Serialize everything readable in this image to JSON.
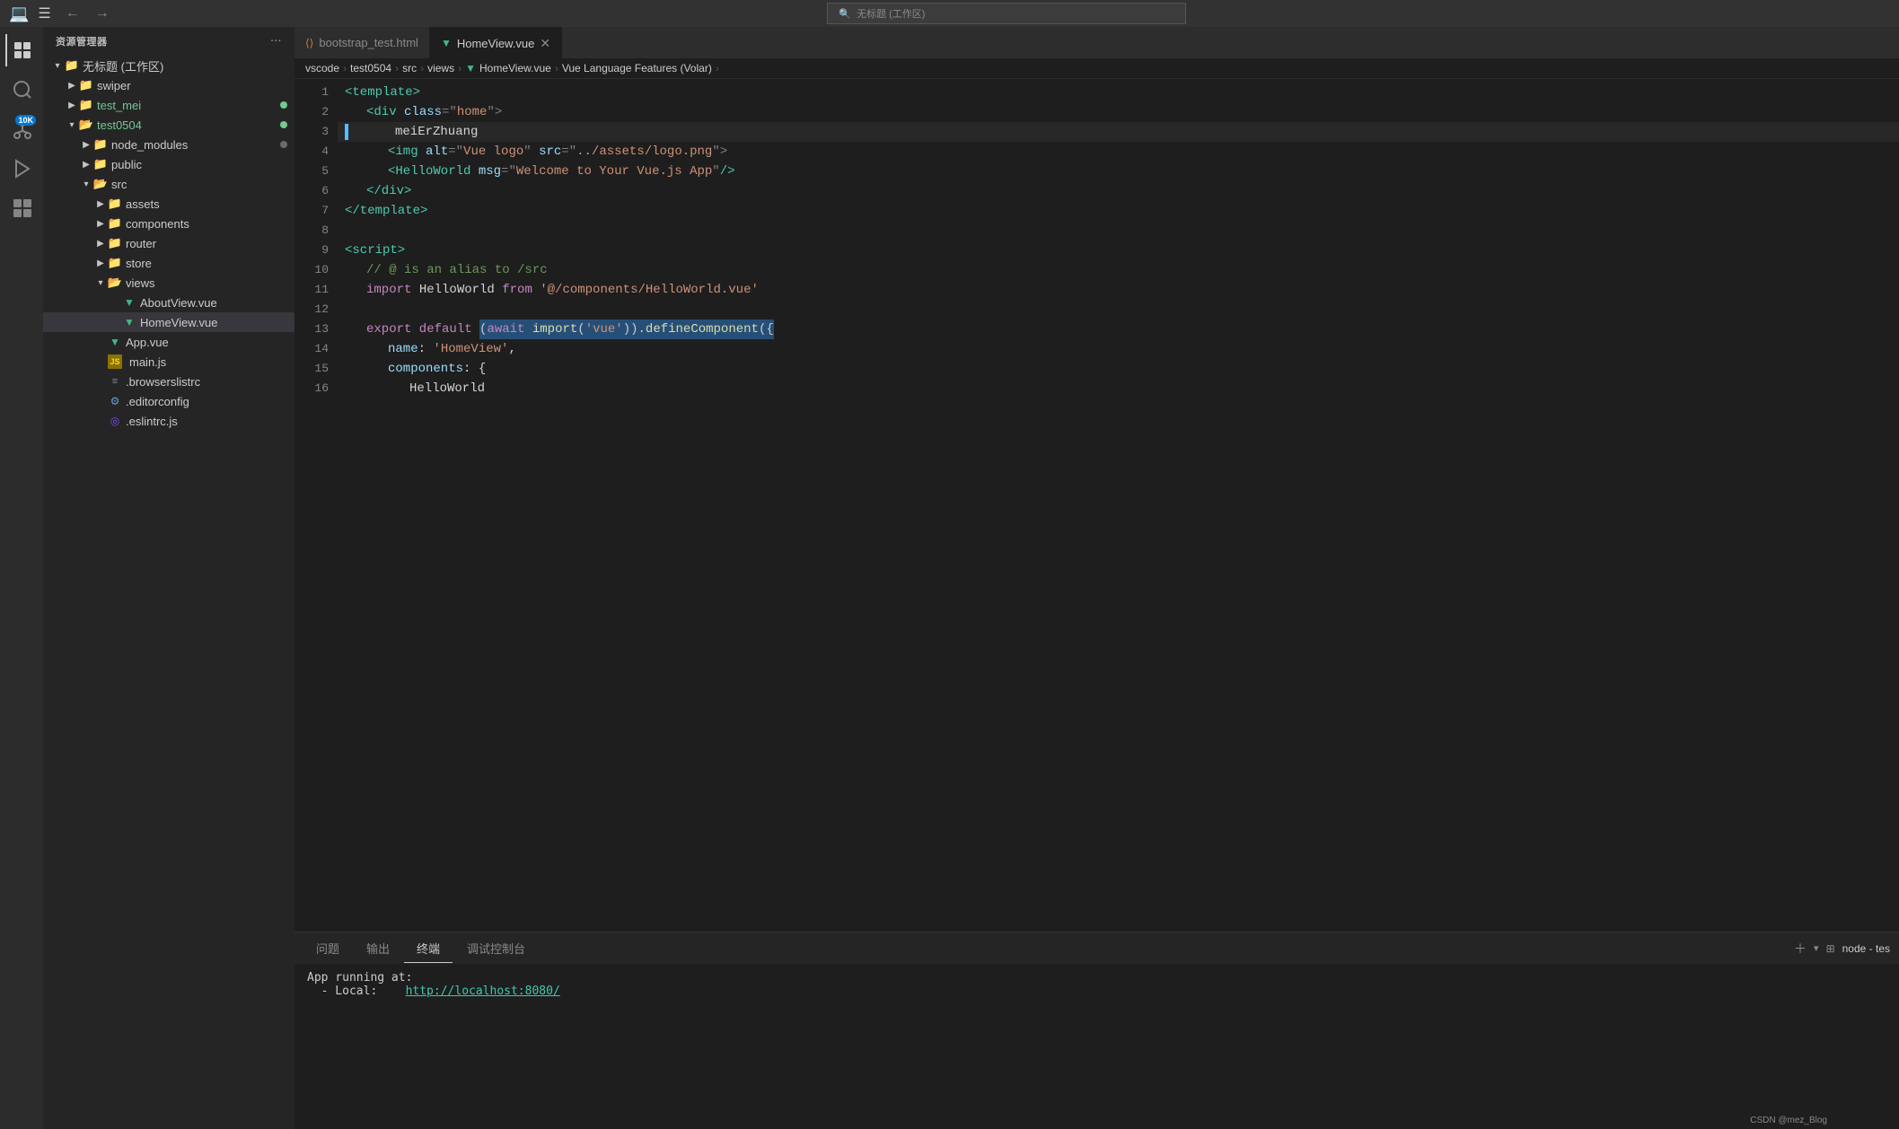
{
  "titlebar": {
    "title": "无标题 (工作区)",
    "back_label": "←",
    "forward_label": "→",
    "search_placeholder": "无标题 (工作区)"
  },
  "sidebar": {
    "header": "资源管理器",
    "workspace_label": "无标题 (工作区)",
    "items": [
      {
        "id": "swiper",
        "label": "swiper",
        "type": "folder",
        "level": 1,
        "expanded": false,
        "dot": ""
      },
      {
        "id": "test_mei",
        "label": "test_mei",
        "type": "folder",
        "level": 1,
        "expanded": false,
        "dot": "green",
        "color": "green"
      },
      {
        "id": "test0504",
        "label": "test0504",
        "type": "folder",
        "level": 1,
        "expanded": true,
        "dot": "green",
        "color": "green"
      },
      {
        "id": "node_modules",
        "label": "node_modules",
        "type": "folder",
        "level": 2,
        "expanded": false,
        "dot": "gray"
      },
      {
        "id": "public",
        "label": "public",
        "type": "folder",
        "level": 2,
        "expanded": false,
        "dot": ""
      },
      {
        "id": "src",
        "label": "src",
        "type": "folder",
        "level": 2,
        "expanded": true,
        "dot": ""
      },
      {
        "id": "assets",
        "label": "assets",
        "type": "folder",
        "level": 3,
        "expanded": false,
        "dot": ""
      },
      {
        "id": "components",
        "label": "components",
        "type": "folder",
        "level": 3,
        "expanded": false,
        "dot": ""
      },
      {
        "id": "router",
        "label": "router",
        "type": "folder",
        "level": 3,
        "expanded": false,
        "dot": ""
      },
      {
        "id": "store",
        "label": "store",
        "type": "folder",
        "level": 3,
        "expanded": false,
        "dot": ""
      },
      {
        "id": "views",
        "label": "views",
        "type": "folder",
        "level": 3,
        "expanded": true,
        "dot": ""
      },
      {
        "id": "aboutview",
        "label": "AboutView.vue",
        "type": "vue",
        "level": 4,
        "expanded": false,
        "dot": ""
      },
      {
        "id": "homeview",
        "label": "HomeView.vue",
        "type": "vue",
        "level": 4,
        "expanded": false,
        "dot": "",
        "selected": true
      },
      {
        "id": "appvue",
        "label": "App.vue",
        "type": "vue",
        "level": 3,
        "expanded": false,
        "dot": ""
      },
      {
        "id": "mainjs",
        "label": "main.js",
        "type": "js",
        "level": 3,
        "expanded": false,
        "dot": ""
      },
      {
        "id": "browserslistrc",
        "label": ".browserslistrc",
        "type": "config",
        "level": 3,
        "expanded": false,
        "dot": ""
      },
      {
        "id": "editorconfig",
        "label": ".editorconfig",
        "type": "gear",
        "level": 3,
        "expanded": false,
        "dot": ""
      },
      {
        "id": "eslintrc",
        "label": ".eslintrc.js",
        "type": "eslint",
        "level": 3,
        "expanded": false,
        "dot": ""
      }
    ]
  },
  "tabs": [
    {
      "id": "bootstrap",
      "label": "bootstrap_test.html",
      "icon": "html",
      "active": false
    },
    {
      "id": "homeview",
      "label": "HomeView.vue",
      "icon": "vue",
      "active": true,
      "closable": true
    }
  ],
  "breadcrumb": {
    "parts": [
      "vscode",
      "test0504",
      "src",
      "views",
      "HomeView.vue",
      "Vue Language Features (Volar)"
    ]
  },
  "code": {
    "lines": [
      {
        "num": 1,
        "content": "<template>"
      },
      {
        "num": 2,
        "content": "  <div class=\"home\">"
      },
      {
        "num": 3,
        "content": "    meiErZhuang",
        "active": true
      },
      {
        "num": 4,
        "content": "    <img alt=\"Vue logo\" src=\"../assets/logo.png\">"
      },
      {
        "num": 5,
        "content": "    <HelloWorld msg=\"Welcome to Your Vue.js App\"/>"
      },
      {
        "num": 6,
        "content": "  </div>"
      },
      {
        "num": 7,
        "content": "</template>"
      },
      {
        "num": 8,
        "content": ""
      },
      {
        "num": 9,
        "content": "<script>"
      },
      {
        "num": 10,
        "content": "// @ is an alias to /src"
      },
      {
        "num": 11,
        "content": "import HelloWorld from '@/components/HelloWorld.vue'"
      },
      {
        "num": 12,
        "content": ""
      },
      {
        "num": 13,
        "content": "export default (await import('vue')).defineComponent({"
      },
      {
        "num": 14,
        "content": "  name: 'HomeView',"
      },
      {
        "num": 15,
        "content": "  components: {"
      },
      {
        "num": 16,
        "content": "    HelloWorld"
      }
    ]
  },
  "panel": {
    "tabs": [
      "问题",
      "输出",
      "终端",
      "调试控制台"
    ],
    "active_tab": "终端",
    "terminal": {
      "line1": "App running at:",
      "line2": "  - Local:   http://localhost:8080/"
    }
  },
  "activity": {
    "items": [
      "explorer",
      "search",
      "source-control",
      "debug",
      "extensions"
    ]
  }
}
